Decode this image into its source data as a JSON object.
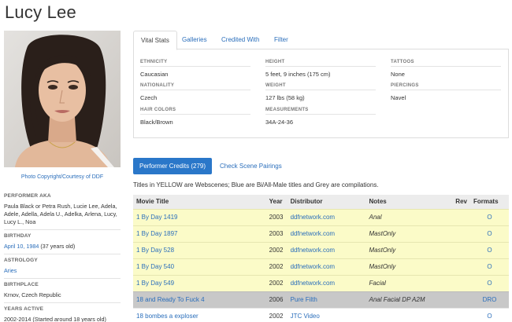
{
  "performer": {
    "name": "Lucy Lee"
  },
  "photo": {
    "caption": "Photo Copyright/Courtesy of DDF"
  },
  "sidebar": {
    "aka_label": "PERFORMER AKA",
    "aka_value": "Paula Black or Petra Rush, Lucie Lee, Adela, Adele, Adella, Adela U., Adelka, Arlena, Lucy, Lucy L., Noa",
    "birthday_label": "BIRTHDAY",
    "birthday_link": "April 10, 1984",
    "birthday_age": " (37 years old)",
    "astrology_label": "ASTROLOGY",
    "astrology_value": "Aries",
    "birthplace_label": "BIRTHPLACE",
    "birthplace_value": "Krnov, Czech Republic",
    "years_label": "YEARS ACTIVE",
    "years_value": "2002-2014 (Started around 18 years old)"
  },
  "tabs": [
    "Vital Stats",
    "Galleries",
    "Credited With",
    "Filter"
  ],
  "stats": {
    "ethnicity_label": "ETHNICITY",
    "ethnicity": "Caucasian",
    "nationality_label": "NATIONALITY",
    "nationality": "Czech",
    "hair_label": "HAIR COLORS",
    "hair": "Black/Brown",
    "height_label": "HEIGHT",
    "height": "5 feet, 9 inches (175 cm)",
    "weight_label": "WEIGHT",
    "weight": "127 lbs (58 kg)",
    "measurements_label": "MEASUREMENTS",
    "measurements": "34A-24-36",
    "tattoos_label": "TATTOOS",
    "tattoos": "None",
    "piercings_label": "PIERCINGS",
    "piercings": "Navel"
  },
  "credits": {
    "button_label": "Performer Credits (279)",
    "pairings_label": "Check Scene Pairings",
    "legend": "Titles in YELLOW are Webscenes; Blue are Bi/All-Male titles and Grey are compilations.",
    "headers": [
      "Movie Title",
      "Year",
      "Distributor",
      "Notes",
      "Rev",
      "Formats"
    ],
    "rows": [
      {
        "title": "1 By Day 1419",
        "year": "2003",
        "distributor": "ddfnetwork.com",
        "notes": "Anal",
        "rev": "",
        "formats": "O",
        "kind": "yellow"
      },
      {
        "title": "1 By Day 1897",
        "year": "2003",
        "distributor": "ddfnetwork.com",
        "notes": "MastOnly",
        "rev": "",
        "formats": "O",
        "kind": "yellow"
      },
      {
        "title": "1 By Day 528",
        "year": "2002",
        "distributor": "ddfnetwork.com",
        "notes": "MastOnly",
        "rev": "",
        "formats": "O",
        "kind": "yellow"
      },
      {
        "title": "1 By Day 540",
        "year": "2002",
        "distributor": "ddfnetwork.com",
        "notes": "MastOnly",
        "rev": "",
        "formats": "O",
        "kind": "yellow"
      },
      {
        "title": "1 By Day 549",
        "year": "2002",
        "distributor": "ddfnetwork.com",
        "notes": "Facial",
        "rev": "",
        "formats": "O",
        "kind": "yellow"
      },
      {
        "title": "18 and Ready To Fuck 4",
        "year": "2006",
        "distributor": "Pure Filth",
        "notes": "Anal Facial DP A2M",
        "rev": "",
        "formats": "DRO",
        "kind": "grey"
      },
      {
        "title": "18 bombes a exploser",
        "year": "2002",
        "distributor": "JTC Video",
        "notes": "",
        "rev": "",
        "formats": "O",
        "kind": "white"
      }
    ]
  }
}
